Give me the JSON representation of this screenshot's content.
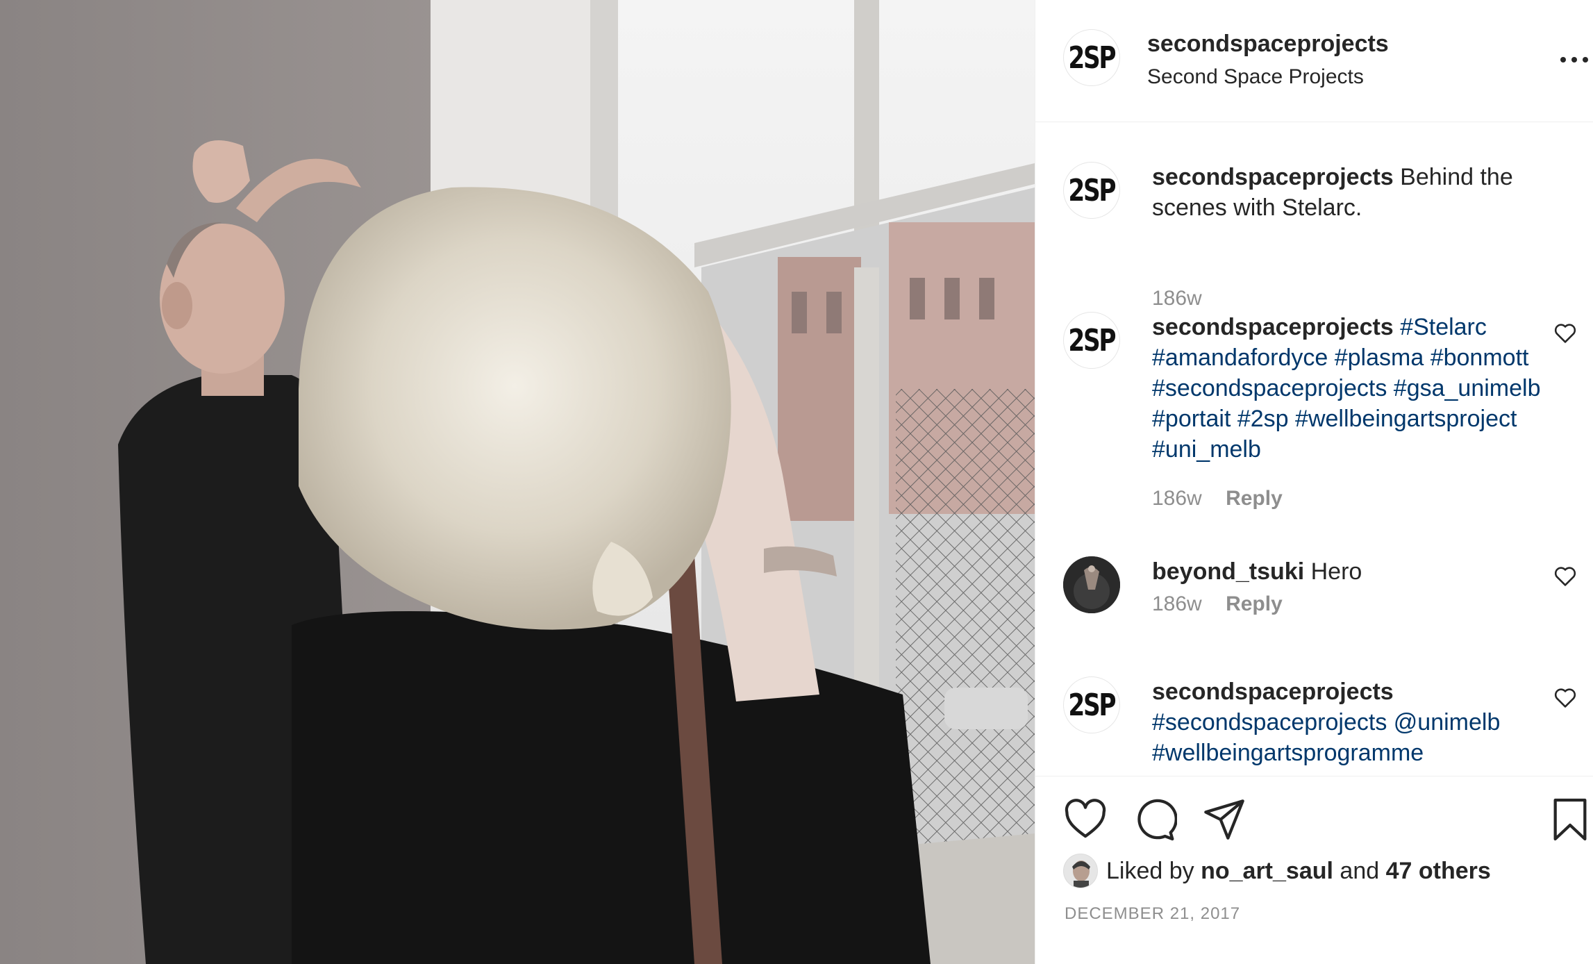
{
  "post": {
    "username": "secondspaceprojects",
    "display_name": "Second Space Projects",
    "avatar_text": "2SP",
    "image_alt": "Behind the scenes photo: a bald man in black posing with a raised hand while a blonde woman photographs him by a large window"
  },
  "comments": [
    {
      "username": "secondspaceprojects",
      "avatar_text": "2SP",
      "text": "Behind the scenes with Stelarc.",
      "tags": [],
      "age": "186w",
      "reply_label": ""
    },
    {
      "username": "secondspaceprojects",
      "avatar_text": "2SP",
      "text": "",
      "tags": [
        "#Stelarc",
        "#amandafordyce",
        "#plasma",
        "#bonmott",
        "#secondspaceprojects",
        "#gsa_unimelb",
        "#portait",
        "#2sp",
        "#wellbeingartsproject",
        "#uni_melb"
      ],
      "age": "186w",
      "reply_label": "Reply"
    },
    {
      "username": "beyond_tsuki",
      "avatar_text": "",
      "text": "Hero",
      "tags": [],
      "age": "186w",
      "reply_label": "Reply"
    },
    {
      "username": "secondspaceprojects",
      "avatar_text": "2SP",
      "text": "",
      "tags": [
        "#secondspaceprojects",
        "@unimelb",
        "#wellbeingartsprogramme"
      ],
      "age": "",
      "reply_label": ""
    }
  ],
  "actions": {
    "like_icon": "heart-outline-icon",
    "comment_icon": "speech-bubble-icon",
    "share_icon": "paper-plane-icon",
    "save_icon": "bookmark-icon"
  },
  "likes": {
    "prefix": "Liked by",
    "user": "no_art_saul",
    "joiner": "and",
    "others": "47 others"
  },
  "date": "DECEMBER 21, 2017",
  "colors": {
    "text": "#262626",
    "muted": "#8e8e8e",
    "hashtag": "#00376b",
    "divider": "#efefef"
  }
}
